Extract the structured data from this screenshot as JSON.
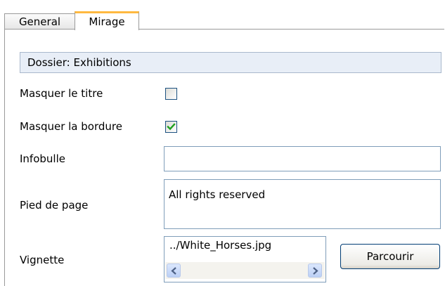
{
  "tabs": [
    {
      "label": "General",
      "active": false
    },
    {
      "label": "Mirage",
      "active": true
    }
  ],
  "colors": {
    "active_tab_accent": "#ffb940",
    "folder_header_bg": "#e8eef7",
    "input_border": "#7f9db9",
    "checkbox_check": "#21a121"
  },
  "folder": {
    "label": "Dossier: Exhibitions"
  },
  "fields": {
    "hide_title": {
      "label": "Masquer le titre",
      "checked": false
    },
    "hide_border": {
      "label": "Masquer la bordure",
      "checked": true
    },
    "tooltip": {
      "label": "Infobulle",
      "value": ""
    },
    "footer": {
      "label": "Pied de page",
      "value": "All rights reserved"
    },
    "thumbnail": {
      "label": "Vignette",
      "value": "../White_Horses.jpg"
    }
  },
  "buttons": {
    "browse_label": "Parcourir"
  },
  "icons": {
    "scroll_left": "chevron-left-icon",
    "scroll_right": "chevron-right-icon",
    "check": "check-icon"
  }
}
